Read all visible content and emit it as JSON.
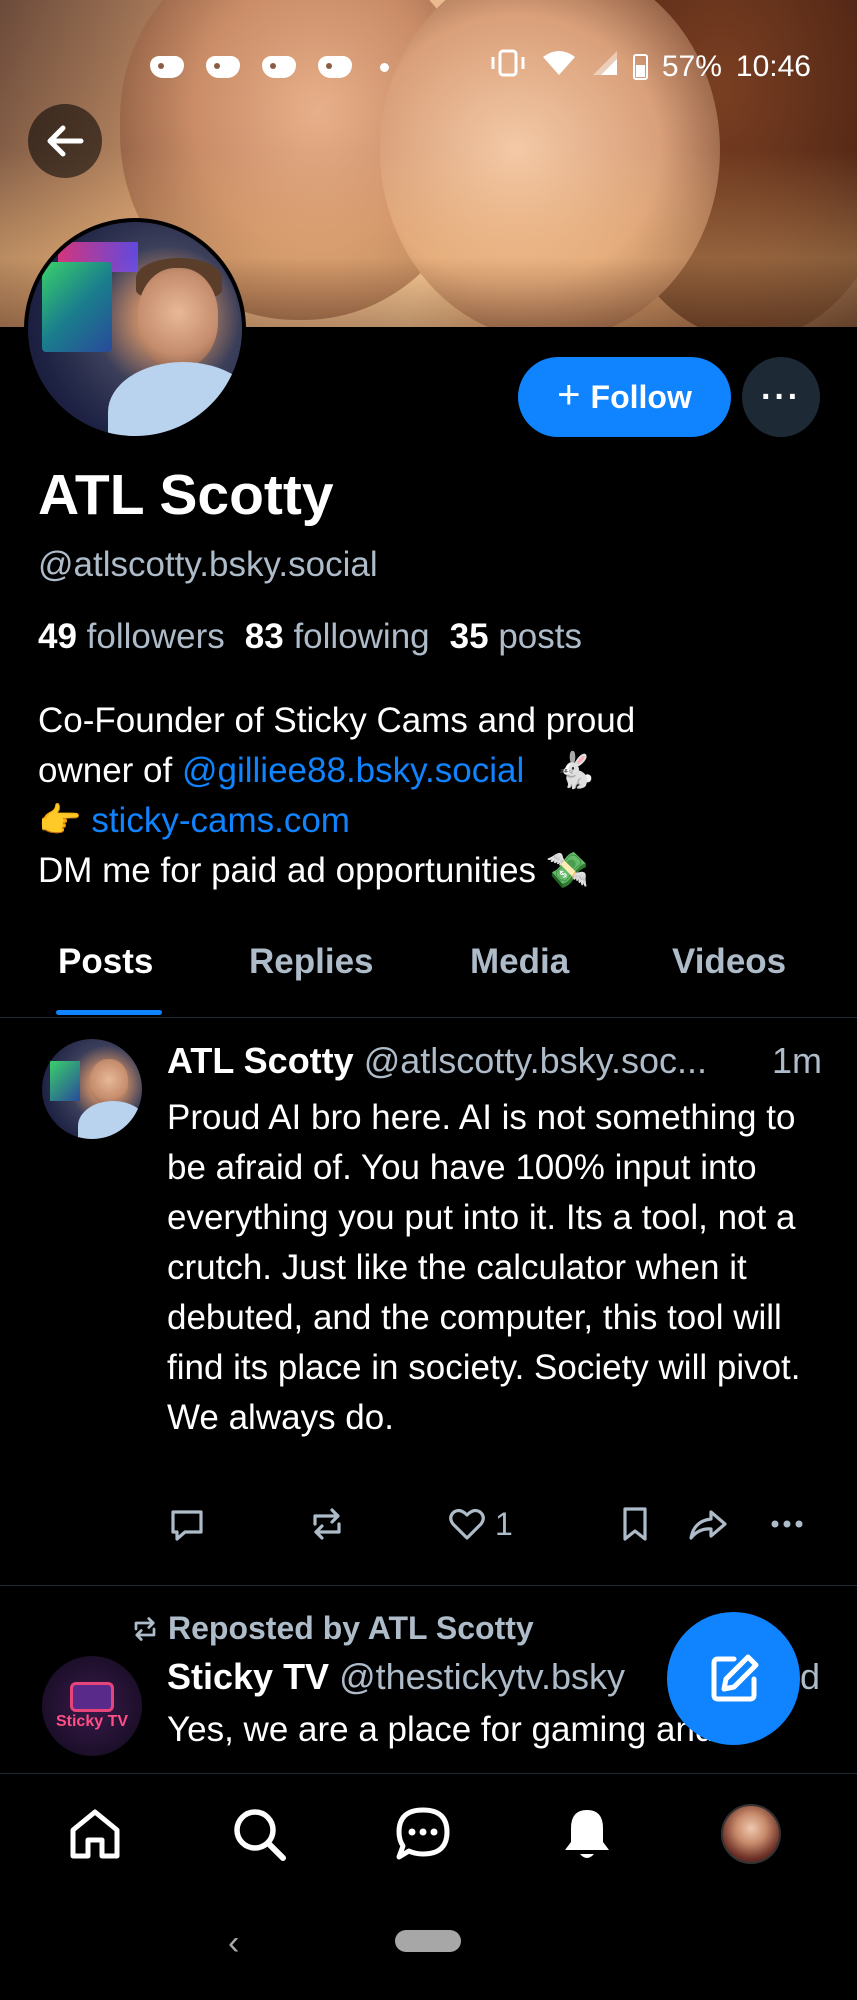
{
  "status_bar": {
    "battery": "57%",
    "time": "10:46"
  },
  "profile": {
    "display_name": "ATL Scotty",
    "handle": "@atlscotty.bsky.social",
    "follow_label": "Follow",
    "follow_icon": "+",
    "more_label": "···",
    "stats": {
      "followers_count": "49",
      "followers_label": "followers",
      "following_count": "83",
      "following_label": "following",
      "posts_count": "35",
      "posts_label": "posts"
    },
    "bio": {
      "line1": "Co-Founder of Sticky Cams and proud",
      "line2_prefix": "owner of",
      "line2_link": "@gilliee88.bsky.social",
      "line2_emoji": "🐇",
      "line3_emoji": "👉",
      "line3_link": "sticky-cams.com",
      "line4": "DM me for paid ad opportunities",
      "line4_emoji": "💸"
    }
  },
  "tabs": [
    {
      "label": "Posts",
      "active": true
    },
    {
      "label": "Replies",
      "active": false
    },
    {
      "label": "Media",
      "active": false
    },
    {
      "label": "Videos",
      "active": false
    }
  ],
  "post": {
    "author": "ATL Scotty",
    "handle": "@atlscotty.bsky.soc...",
    "time": "1m",
    "text": "Proud AI bro here. AI is not something to be afraid of. You have 100% input into everything you put into it. Its a tool, not a crutch.  Just like the calculator when it debuted, and the computer,  this tool will find its place in society. Society will pivot. We always do.",
    "like_count": "1"
  },
  "repost": {
    "label": "Reposted by ATL Scotty",
    "author": "Sticky TV",
    "handle": "@thestickytv.bsky",
    "time": "d",
    "text": "Yes, we are a place for gaming and",
    "avatar_label": "Sticky TV"
  },
  "colors": {
    "accent": "#1083fe",
    "muted_text": "#aebbc9",
    "background": "#000000",
    "divider": "#1f2a35"
  }
}
